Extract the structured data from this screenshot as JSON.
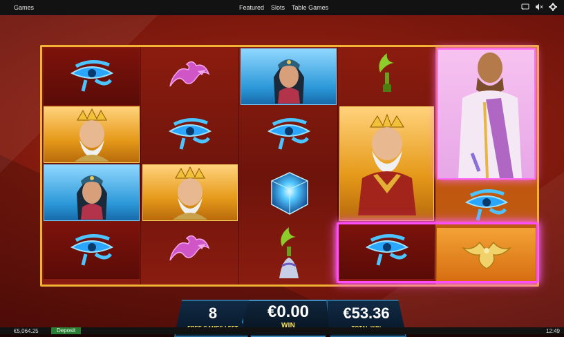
{
  "topbar": {
    "left_label": "Games",
    "nav": [
      "Featured",
      "Slots",
      "Table Games"
    ],
    "icons": [
      "cast-icon",
      "sound-muted-icon",
      "settings-gear-icon"
    ]
  },
  "game": {
    "reels": {
      "columns": 5,
      "rows": 4,
      "grid": [
        [
          "eye-of-horus",
          "dragon",
          "queen",
          "green-crescent-statue",
          "sultan"
        ],
        [
          "king",
          "eye-of-horus",
          "eye-of-horus",
          "king",
          "sultan"
        ],
        [
          "queen",
          "king",
          "crystal-cube",
          "king",
          "eye-of-horus"
        ],
        [
          "eye-of-horus",
          "dragon",
          "green-crescent-statue",
          "eye-of-horus",
          "golden-eagle"
        ]
      ],
      "highlight": {
        "from_col": 4,
        "to_col": 5,
        "row": 4
      }
    }
  },
  "hud": {
    "free_games_left": {
      "value": "8",
      "label": "FREE GAMES LEFT"
    },
    "win": {
      "value": "€0.00",
      "label": "WIN"
    },
    "total_win": {
      "value": "€53.36",
      "label": "TOTAL WIN"
    }
  },
  "footer": {
    "balance": "€5,064.25",
    "deposit": "Deposit",
    "time": "12:49"
  },
  "colors": {
    "frame": "#f2b233",
    "highlight": "#ff4dff",
    "hud_label": "#ffe45a"
  }
}
